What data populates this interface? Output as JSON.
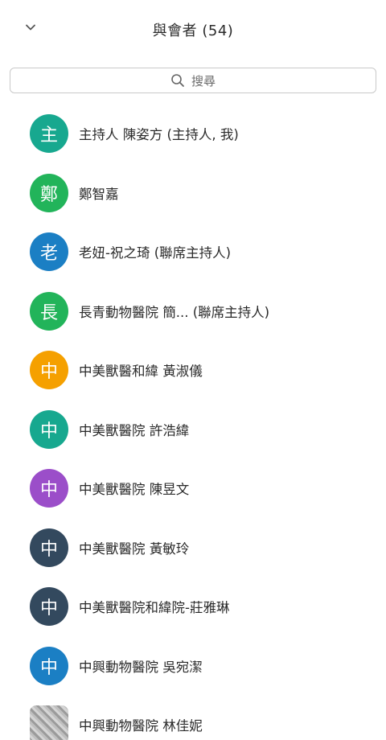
{
  "header": {
    "title": "與會者 (54)",
    "collapse_icon": "chevron-down-icon"
  },
  "search": {
    "placeholder": "搜尋",
    "icon": "search-icon"
  },
  "colors": {
    "muted": "#e0303a",
    "share_green": "#1aa049",
    "record_red": "#e01e2f"
  },
  "participants": [
    {
      "initial": "主",
      "name": "主持人 陳姿方 (主持人, 我)",
      "avatar_color": "#17a88f",
      "recording": true,
      "sharing": false,
      "mic": "muted",
      "video": "off"
    },
    {
      "initial": "鄭",
      "name": "鄭智嘉",
      "avatar_color": "#22b45a",
      "recording": false,
      "sharing": true,
      "mic": "on",
      "video": "off"
    },
    {
      "initial": "老",
      "name": "老妞-祝之琦 (聯席主持人)",
      "avatar_color": "#1b7fc4",
      "recording": false,
      "sharing": false,
      "mic": "muted",
      "video": "off"
    },
    {
      "initial": "長",
      "name": "長青動物醫院 簡... (聯席主持人)",
      "avatar_color": "#22b45a",
      "recording": false,
      "sharing": false,
      "mic": "muted",
      "video": "off"
    },
    {
      "initial": "中",
      "name": "中美獸醫和緯 黃淑儀",
      "avatar_color": "#f5a000",
      "recording": false,
      "sharing": false,
      "mic": "muted",
      "video": "off"
    },
    {
      "initial": "中",
      "name": "中美獸醫院 許浩緯",
      "avatar_color": "#17a88f",
      "recording": false,
      "sharing": false,
      "mic": "muted",
      "video": "off"
    },
    {
      "initial": "中",
      "name": "中美獸醫院 陳昱文",
      "avatar_color": "#9b4ec9",
      "recording": false,
      "sharing": false,
      "mic": "muted",
      "video": "off"
    },
    {
      "initial": "中",
      "name": "中美獸醫院 黃敏玲",
      "avatar_color": "#33495e",
      "recording": false,
      "sharing": false,
      "mic": "muted",
      "video": "off"
    },
    {
      "initial": "中",
      "name": "中美獸醫院和緯院-莊雅琳",
      "avatar_color": "#33495e",
      "recording": false,
      "sharing": false,
      "mic": "muted",
      "video": "off"
    },
    {
      "initial": "中",
      "name": "中興動物醫院 吳宛潔",
      "avatar_color": "#1b7fc4",
      "recording": false,
      "sharing": false,
      "mic": "muted",
      "video": "off"
    },
    {
      "initial": "",
      "name": "中興動物醫院 林佳妮",
      "avatar_color": "#b5b5b5",
      "photo": true,
      "recording": false,
      "sharing": false,
      "mic": "muted",
      "video": "off"
    }
  ]
}
